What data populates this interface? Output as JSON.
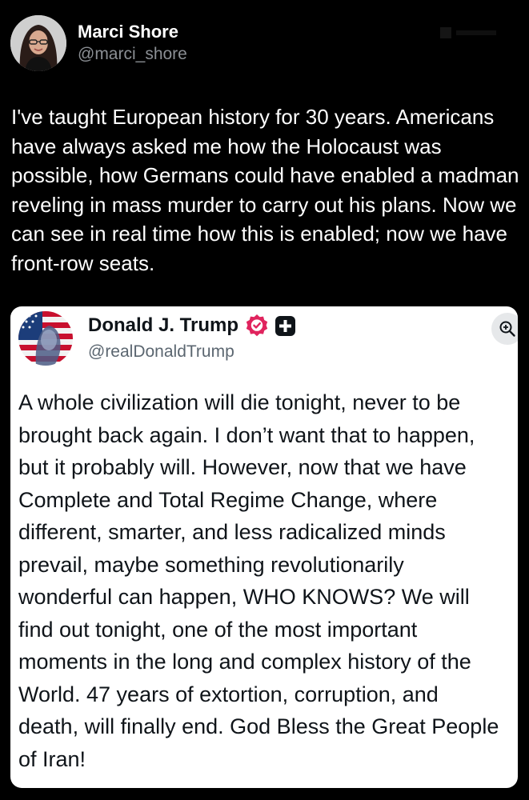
{
  "author": {
    "display_name": "Marci Shore",
    "handle": "@marci_shore"
  },
  "tweet_text": "I've taught European history for 30 years. Americans have always asked me how the Holocaust was possible, how Germans could have enabled a madman reveling in mass murder to carry out his plans. Now we can see in real time how this is enabled; now we have front-row seats.",
  "quoted_post": {
    "display_name": "Donald J. Trump",
    "handle": "@realDonaldTrump",
    "verified_icon": "verified-badge-icon",
    "badge_icon": "plus-square-icon",
    "zoom_icon": "zoom-in-icon",
    "text": "A whole civilization will die tonight, never to be brought back again. I don’t want that to happen, but it probably will. However, now that we have Complete and Total Regime Change, where different, smarter, and less radicalized minds prevail, maybe something revolutionarily wonderful can happen, WHO KNOWS? We will find out tonight, one of the most important moments in the long and complex history of the World. 47 years of extortion, corruption, and death, will finally end. God Bless the Great People of Iran!"
  },
  "colors": {
    "background": "#000000",
    "primary_text": "#ffffff",
    "secondary_text": "#8b8f94",
    "card_background": "#ffffff",
    "card_text": "#0f1419",
    "verified_badge": "#e0245e"
  }
}
